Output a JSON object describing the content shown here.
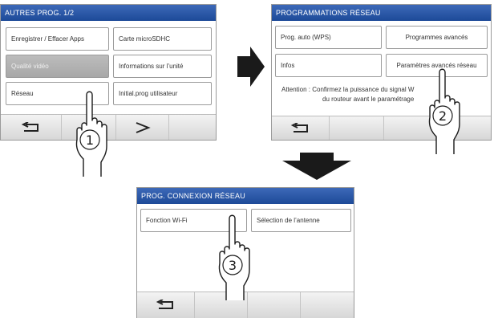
{
  "screen1": {
    "title": "AUTRES PROG. 1/2",
    "buttons": {
      "record_erase": "Enregistrer / Effacer Apps",
      "microsd": "Carte microSDHC",
      "video_quality": "Qualité vidéo",
      "unit_info": "Informations sur l’unité",
      "network": "Réseau",
      "init_user": "Initial.prog utilisateur"
    },
    "step": "1"
  },
  "screen2": {
    "title": "PROGRAMMATIONS RÉSEAU",
    "buttons": {
      "wps": "Prog. auto (WPS)",
      "advanced_programs": "Programmes avancés",
      "info": "Infos",
      "advanced_network": "Paramètres avancés réseau"
    },
    "attention_line1": "Attention : Confirmez la puissance du signal W",
    "attention_line2": "du routeur avant le paramétrage",
    "step": "2"
  },
  "screen3": {
    "title": "PROG. CONNEXION RÉSEAU",
    "buttons": {
      "wifi": "Fonction Wi-Fi",
      "antenna": "Sélection de l’antenne"
    },
    "step": "3"
  },
  "icons": {
    "back": "back-arrow-icon",
    "next": "next-chevron-icon",
    "flow_right": "flow-arrow-right",
    "flow_down": "flow-arrow-down",
    "hand": "pointing-hand-icon"
  },
  "colors": {
    "titlebar": "#2a58a8",
    "disabled_button": "#b0b0b0"
  }
}
